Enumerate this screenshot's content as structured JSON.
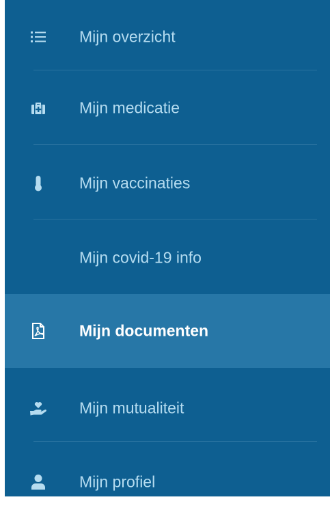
{
  "sidebar": {
    "accent_color": "#0e5f91",
    "active_color": "#2777a7",
    "items": [
      {
        "label": "Mijn overzicht",
        "icon": "list-icon",
        "active": false
      },
      {
        "label": "Mijn medicatie",
        "icon": "medkit-icon",
        "active": false
      },
      {
        "label": "Mijn vaccinaties",
        "icon": "thermometer-icon",
        "active": false
      },
      {
        "label": "Mijn covid-19 info",
        "icon": "",
        "active": false
      },
      {
        "label": "Mijn documenten",
        "icon": "pdf-file-icon",
        "active": true
      },
      {
        "label": "Mijn mutualiteit",
        "icon": "hand-heart-icon",
        "active": false
      },
      {
        "label": "Mijn profiel",
        "icon": "user-icon",
        "active": false
      }
    ]
  }
}
